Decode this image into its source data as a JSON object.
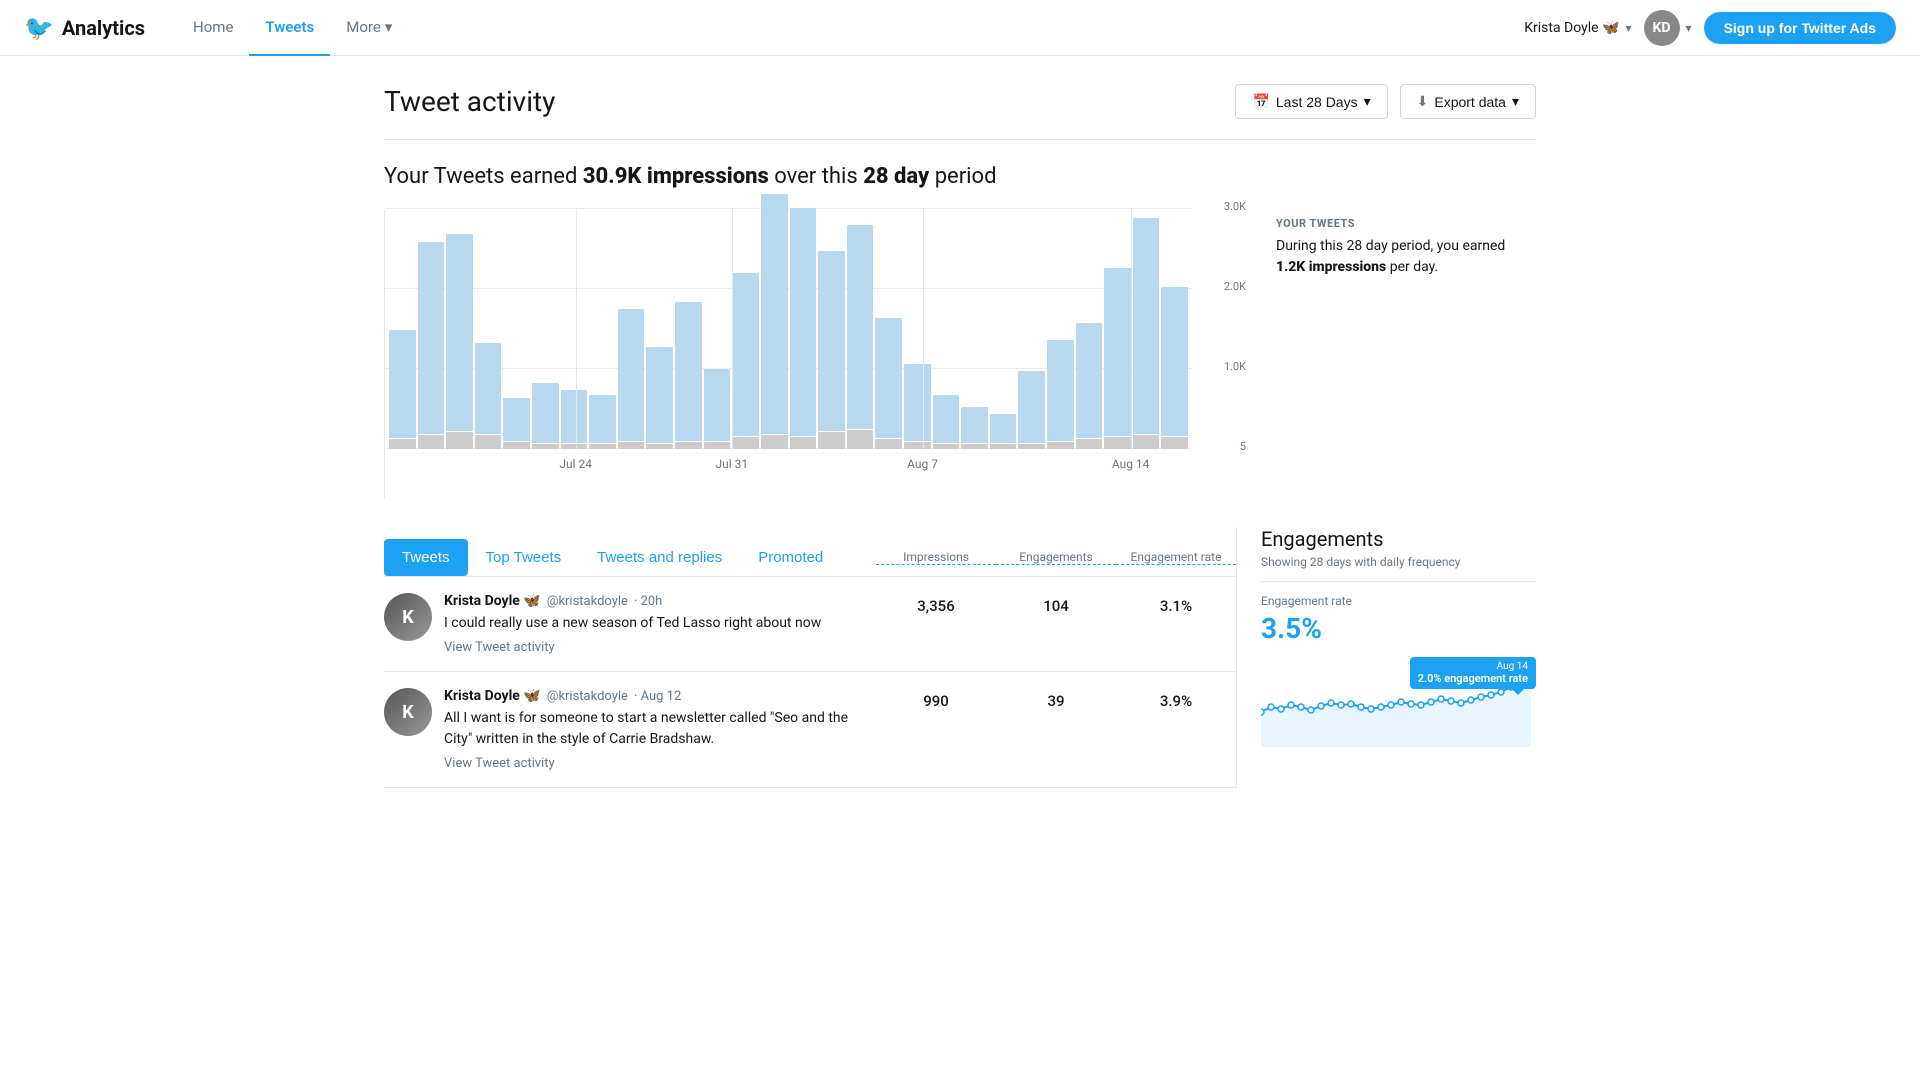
{
  "brand": {
    "name": "Analytics",
    "bird_char": "🐦"
  },
  "nav": {
    "links": [
      {
        "label": "Home",
        "active": false
      },
      {
        "label": "Tweets",
        "active": true
      },
      {
        "label": "More",
        "active": false,
        "dropdown": true
      }
    ],
    "user": {
      "name": "Krista Doyle 🦋",
      "initials": "KD"
    },
    "signup_label": "Sign up for Twitter Ads"
  },
  "page": {
    "title": "Tweet activity",
    "date_range_label": "Last 28 Days",
    "export_label": "Export data"
  },
  "summary": {
    "prefix": "Your Tweets earned ",
    "impressions": "30.9K impressions",
    "suffix": " over this ",
    "period": "28 day",
    "suffix2": " period"
  },
  "chart": {
    "y_labels": [
      "3.0K",
      "2.0K",
      "1.0K",
      "5"
    ],
    "x_labels": [
      {
        "label": "Jul 24",
        "pct": 22
      },
      {
        "label": "Jul 31",
        "pct": 40
      },
      {
        "label": "Aug 7",
        "pct": 62
      },
      {
        "label": "Aug 14",
        "pct": 86
      }
    ],
    "bars": [
      {
        "impressions": 45,
        "engagements": 4
      },
      {
        "impressions": 80,
        "engagements": 6
      },
      {
        "impressions": 82,
        "engagements": 7
      },
      {
        "impressions": 38,
        "engagements": 6
      },
      {
        "impressions": 18,
        "engagements": 3
      },
      {
        "impressions": 25,
        "engagements": 2
      },
      {
        "impressions": 22,
        "engagements": 2
      },
      {
        "impressions": 20,
        "engagements": 2
      },
      {
        "impressions": 55,
        "engagements": 3
      },
      {
        "impressions": 40,
        "engagements": 2
      },
      {
        "impressions": 58,
        "engagements": 3
      },
      {
        "impressions": 30,
        "engagements": 3
      },
      {
        "impressions": 68,
        "engagements": 5
      },
      {
        "impressions": 100,
        "engagements": 6
      },
      {
        "impressions": 95,
        "engagements": 5
      },
      {
        "impressions": 75,
        "engagements": 7
      },
      {
        "impressions": 85,
        "engagements": 8
      },
      {
        "impressions": 50,
        "engagements": 4
      },
      {
        "impressions": 32,
        "engagements": 3
      },
      {
        "impressions": 20,
        "engagements": 2
      },
      {
        "impressions": 15,
        "engagements": 2
      },
      {
        "impressions": 12,
        "engagements": 2
      },
      {
        "impressions": 30,
        "engagements": 2
      },
      {
        "impressions": 42,
        "engagements": 3
      },
      {
        "impressions": 48,
        "engagements": 4
      },
      {
        "impressions": 70,
        "engagements": 5
      },
      {
        "impressions": 90,
        "engagements": 6
      },
      {
        "impressions": 62,
        "engagements": 5
      }
    ],
    "your_tweets_label": "YOUR TWEETS",
    "your_tweets_desc_prefix": "During this 28 day period, you earned ",
    "your_tweets_highlight": "1.2K impressions",
    "your_tweets_desc_suffix": " per day."
  },
  "tabs": [
    {
      "label": "Tweets",
      "active": true
    },
    {
      "label": "Top Tweets",
      "active": false
    },
    {
      "label": "Tweets and replies",
      "active": false
    },
    {
      "label": "Promoted",
      "active": false
    }
  ],
  "col_headers": [
    {
      "label": "Impressions"
    },
    {
      "label": "Engagements"
    },
    {
      "label": "Engagement rate"
    }
  ],
  "tweets": [
    {
      "name": "Krista Doyle 🦋",
      "handle": "@kristakdoyle",
      "time": "20h",
      "text": "I could really use a new season of Ted Lasso right about now",
      "view_activity": "View Tweet activity",
      "impressions": "3,356",
      "engagements": "104",
      "engagement_rate": "3.1%"
    },
    {
      "name": "Krista Doyle 🦋",
      "handle": "@kristakdoyle",
      "time": "Aug 12",
      "text": "All I want is for someone to start a newsletter called \"Seo and the City\" written in the style of Carrie Bradshaw.",
      "view_activity": "View Tweet activity",
      "impressions": "990",
      "engagements": "39",
      "engagement_rate": "3.9%"
    }
  ],
  "right_panel": {
    "title": "Engagements",
    "subtitle": "Showing 28 days with daily frequency",
    "rate_label": "Engagement rate",
    "rate_value": "3.5%",
    "tooltip_date": "Aug 14",
    "tooltip_value": "2.0% engagement rate"
  }
}
